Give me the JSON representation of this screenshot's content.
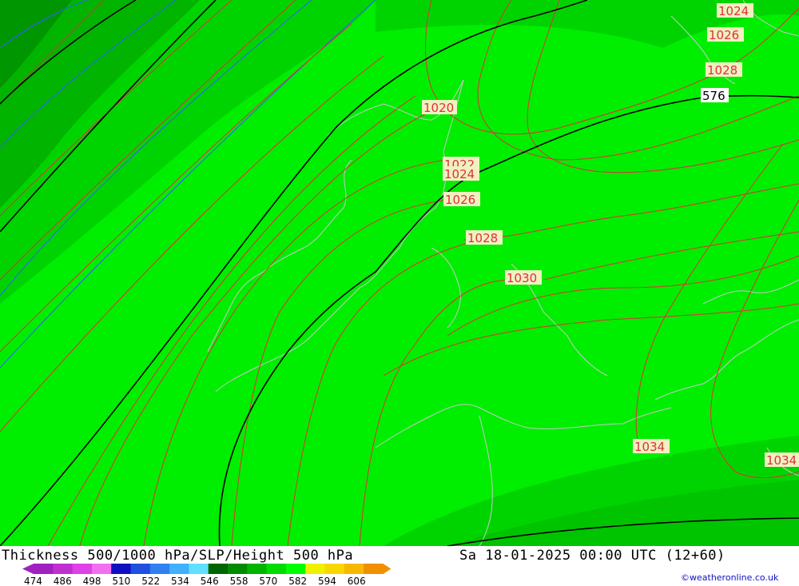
{
  "title": "Thickness 500/1000 hPa/SLP/Height 500 hPa",
  "datetime": "Sa 18-01-2025 00:00 UTC (12+60)",
  "credit": "©weatheronline.co.uk",
  "legend": {
    "ticks": [
      "474",
      "486",
      "498",
      "510",
      "522",
      "534",
      "546",
      "558",
      "570",
      "582",
      "594",
      "606"
    ],
    "colors": [
      "#a020c0",
      "#c030d0",
      "#e040e8",
      "#f070f0",
      "#1010c0",
      "#2050e0",
      "#3080f0",
      "#40b0ff",
      "#60e0ff",
      "#006400",
      "#008c00",
      "#00b400",
      "#00dc00",
      "#00ff00",
      "#f0f000",
      "#f8d800",
      "#f8b800",
      "#f09000"
    ]
  },
  "isobar_labels": [
    "1020",
    "1022",
    "1024",
    "1026",
    "1028",
    "1030",
    "1034",
    "1034",
    "1024",
    "1026",
    "1028"
  ],
  "height_labels": [
    "576"
  ],
  "colors": {
    "field_main": "#00ee00",
    "field_dark": "#00c800",
    "field_darker": "#00a000",
    "isobar": "#e0303a",
    "height_contour": "#000000",
    "coastline": "#c0c0c0"
  }
}
